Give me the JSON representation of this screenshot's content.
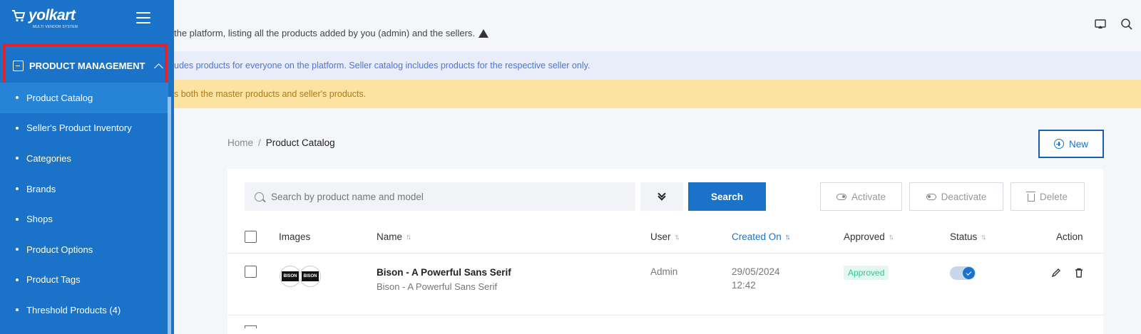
{
  "brand": {
    "name": "yolkart",
    "tagline": "MULTI VENDOR SYSTEM"
  },
  "sidebar": {
    "section_label": "PRODUCT MANAGEMENT",
    "items": [
      {
        "label": "Product Catalog",
        "active": true
      },
      {
        "label": "Seller's Product Inventory"
      },
      {
        "label": "Categories"
      },
      {
        "label": "Brands"
      },
      {
        "label": "Shops"
      },
      {
        "label": "Product Options"
      },
      {
        "label": "Product Tags"
      },
      {
        "label": "Threshold Products (4)"
      }
    ]
  },
  "header": {
    "message": "the platform, listing all the products added by you (admin) and the sellers.",
    "icons": [
      "cast-icon",
      "search-icon"
    ]
  },
  "banners": {
    "info": "udes products for everyone on the platform. Seller catalog includes products for the respective seller only.",
    "warning": "s both the master products and seller's products."
  },
  "breadcrumb": {
    "home": "Home",
    "separator": "/",
    "current": "Product Catalog"
  },
  "toolbar": {
    "new_label": "New",
    "search_placeholder": "Search by product name and model",
    "search_label": "Search",
    "activate_label": "Activate",
    "deactivate_label": "Deactivate",
    "delete_label": "Delete"
  },
  "table": {
    "columns": [
      "Images",
      "Name",
      "User",
      "Created On",
      "Approved",
      "Status",
      "Action"
    ],
    "sorted_column": "Created On",
    "rows": [
      {
        "name": "Bison - A Powerful Sans Serif",
        "subtitle": "Bison - A Powerful Sans Serif",
        "user": "Admin",
        "created_date": "29/05/2024",
        "created_time": "12:42",
        "approved": "Approved",
        "status": true,
        "thumb_labels": [
          "BISON",
          "BISON"
        ]
      }
    ]
  },
  "colors": {
    "sidebar": "#1a73c8",
    "highlight_box": "#e32229",
    "primary": "#1a73c8",
    "info_banner_bg": "#e8edf9",
    "warning_banner_bg": "#fde3a1",
    "approved_badge": "#2fc591"
  }
}
